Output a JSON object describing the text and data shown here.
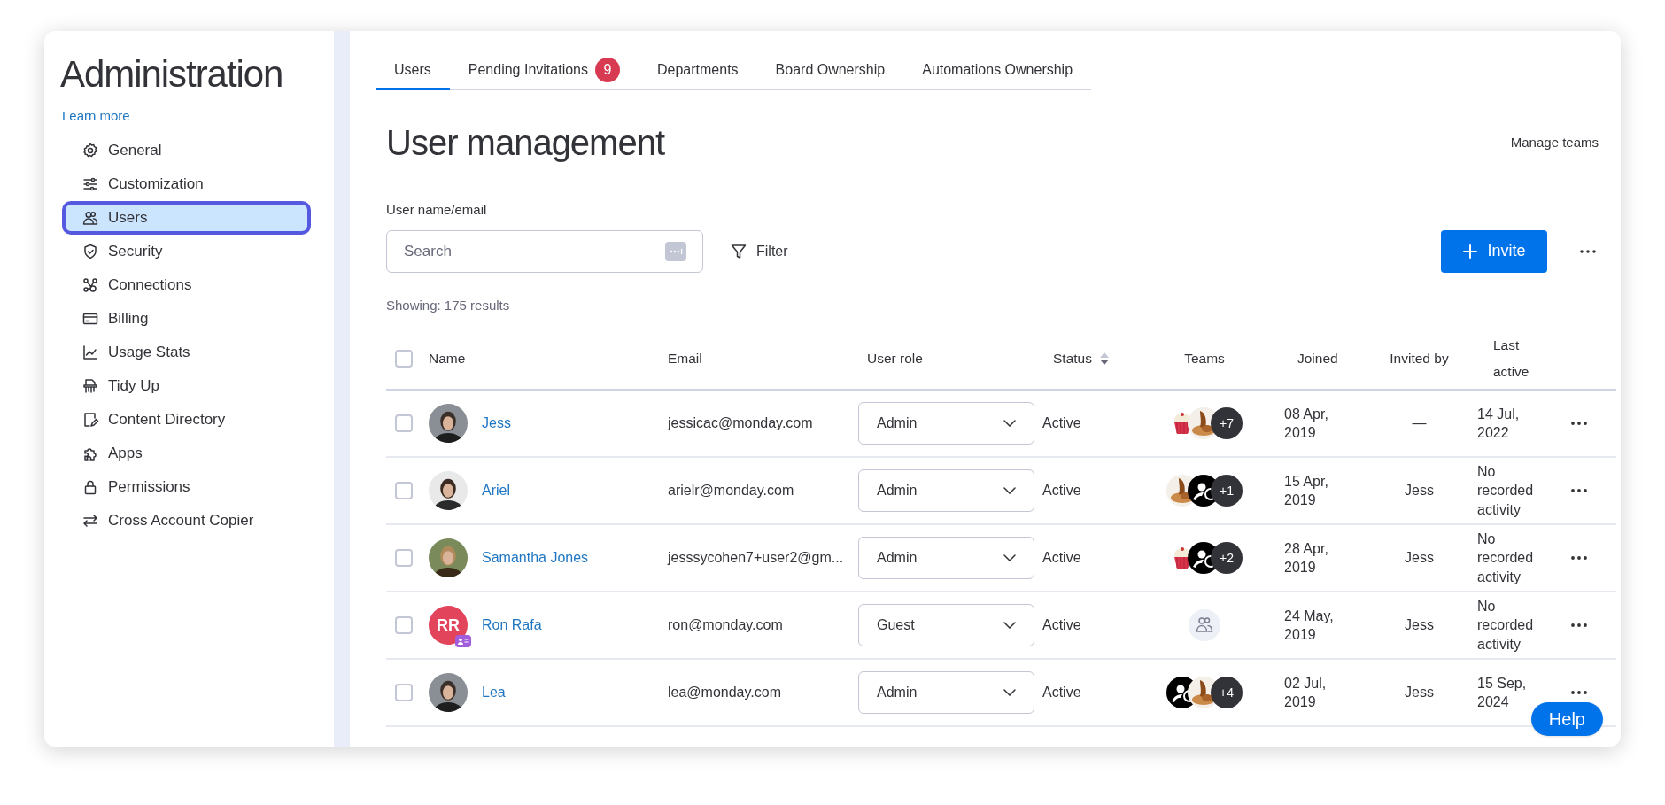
{
  "sidebar": {
    "title": "Administration",
    "link": "Learn more",
    "items": [
      {
        "label": "General",
        "selected": false
      },
      {
        "label": "Customization",
        "selected": false
      },
      {
        "label": "Users",
        "selected": true
      },
      {
        "label": "Security",
        "selected": false
      },
      {
        "label": "Connections",
        "selected": false
      },
      {
        "label": "Billing",
        "selected": false
      },
      {
        "label": "Usage Stats",
        "selected": false
      },
      {
        "label": "Tidy Up",
        "selected": false
      },
      {
        "label": "Content Directory",
        "selected": false
      },
      {
        "label": "Apps",
        "selected": false
      },
      {
        "label": "Permissions",
        "selected": false
      },
      {
        "label": "Cross Account Copier",
        "selected": false
      }
    ]
  },
  "tabs": [
    {
      "label": "Users",
      "selected": true
    },
    {
      "label": "Pending Invitations",
      "selected": false,
      "badge": "9"
    },
    {
      "label": "Departments",
      "selected": false
    },
    {
      "label": "Board Ownership",
      "selected": false
    },
    {
      "label": "Automations Ownership",
      "selected": false
    }
  ],
  "heading": "User management",
  "manage_teams": "Manage teams",
  "search": {
    "label": "User name/email",
    "placeholder": "Search"
  },
  "filter": "Filter",
  "invite": "Invite",
  "results": "Showing: 175 results",
  "table": {
    "select_all": {
      "checked": false
    },
    "columns": [
      {
        "label": "Name",
        "sortable": false
      },
      {
        "label": "Email",
        "sortable": false
      },
      {
        "label": "User role",
        "sortable": false
      },
      {
        "label": "Status",
        "sortable": true
      },
      {
        "label": "Teams",
        "sortable": false
      },
      {
        "label": "Joined",
        "sortable": false
      },
      {
        "label": "Invited by",
        "sortable": false
      },
      {
        "label": "Last active",
        "sortable": false
      }
    ],
    "rows": [
      {
        "checked": false,
        "avatar": {
          "kind": "picture"
        },
        "name": "Jess",
        "email": "jessicac@monday.com",
        "role": "Admin",
        "status": "Active",
        "teams": [
          {
            "kind": "picture"
          },
          {
            "kind": "picture"
          }
        ],
        "more_teams": "+7",
        "joined": "08 Apr, 2019",
        "invited_by": "—",
        "last_active": "14 Jul, 2022"
      },
      {
        "checked": false,
        "avatar": {
          "kind": "picture"
        },
        "name": "Ariel",
        "email": "arielr@monday.com",
        "role": "Admin",
        "status": "Active",
        "teams": [
          {
            "kind": "picture"
          },
          {
            "kind": "logo"
          }
        ],
        "more_teams": "+1",
        "joined": "15 Apr, 2019",
        "invited_by": "Jess",
        "last_active": "No recorded activity"
      },
      {
        "checked": false,
        "avatar": {
          "kind": "picture"
        },
        "name": "Samantha Jones",
        "email": "jesssycohen7+user2@gm...",
        "role": "Admin",
        "status": "Active",
        "teams": [
          {
            "kind": "picture"
          },
          {
            "kind": "logo"
          }
        ],
        "more_teams": "+2",
        "joined": "28 Apr, 2019",
        "invited_by": "Jess",
        "last_active": "No recorded activity"
      },
      {
        "checked": false,
        "avatar": {
          "kind": "initials",
          "text": "RR",
          "color": "#e2445c",
          "guest": true
        },
        "name": "Ron Rafa",
        "email": "ron@monday.com",
        "role": "Guest",
        "status": "Active",
        "teams": [
          {
            "kind": "empty"
          }
        ],
        "joined": "24 May, 2019",
        "invited_by": "Jess",
        "last_active": "No recorded activity"
      },
      {
        "checked": false,
        "avatar": {
          "kind": "picture"
        },
        "name": "Lea",
        "email": "lea@monday.com",
        "role": "Admin",
        "status": "Active",
        "teams": [
          {
            "kind": "logo"
          },
          {
            "kind": "picture"
          }
        ],
        "more_teams": "+4",
        "joined": "02 Jul, 2019",
        "invited_by": "Jess",
        "last_active": "15 Sep, 2024"
      }
    ]
  },
  "help": "Help"
}
